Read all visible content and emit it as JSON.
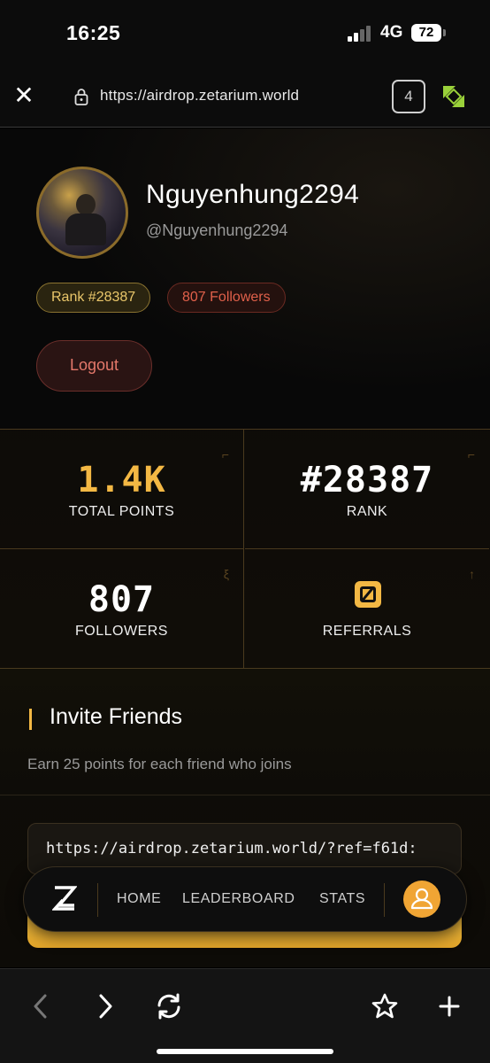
{
  "status_bar": {
    "time": "16:25",
    "network": "4G",
    "battery": "72"
  },
  "browser": {
    "url": "https://airdrop.zetarium.world",
    "tab_count": "4"
  },
  "profile": {
    "username": "Nguyenhung2294",
    "handle": "@Nguyenhung2294",
    "rank_badge": "Rank #28387",
    "followers_badge": "807 Followers",
    "logout_label": "Logout"
  },
  "stats": {
    "points_value": "1.4K",
    "points_label": "TOTAL POINTS",
    "rank_value": "#28387",
    "rank_label": "RANK",
    "followers_value": "807",
    "followers_label": "FOLLOWERS",
    "referrals_label": "REFERRALS"
  },
  "invite": {
    "title": "Invite Friends",
    "subtitle": "Earn 25 points for each friend who joins",
    "ref_link": "https://airdrop.zetarium.world/?ref=f61d:"
  },
  "nav": {
    "home": "HOME",
    "leaderboard": "LEADERBOARD",
    "stats": "STATS"
  },
  "colors": {
    "accent_gold": "#f3b844",
    "rank_badge": "#e9c66a",
    "followers_badge": "#e0604a",
    "logout": "#e4786a"
  },
  "icons": [
    "close-icon",
    "lock-icon",
    "tabs-icon",
    "extension-icon",
    "referral-icon",
    "zetarium-logo-icon",
    "user-icon",
    "back-icon",
    "forward-icon",
    "reload-icon",
    "star-icon",
    "plus-icon"
  ]
}
